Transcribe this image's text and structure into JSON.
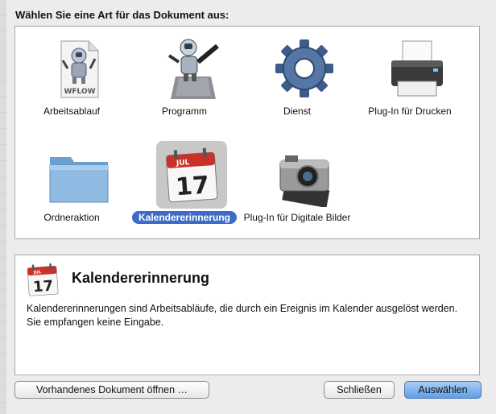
{
  "dialog": {
    "prompt": "Wählen Sie eine Art für das Dokument aus:",
    "selected": "Kalendererinnerung"
  },
  "types": [
    {
      "label": "Arbeitsablauf",
      "icon": "workflow-document-icon",
      "badge": "WFLOW"
    },
    {
      "label": "Programm",
      "icon": "automator-robot-icon"
    },
    {
      "label": "Dienst",
      "icon": "gear-icon"
    },
    {
      "label": "Plug-In für Drucken",
      "icon": "printer-icon"
    },
    {
      "label": "Ordneraktion",
      "icon": "folder-icon"
    },
    {
      "label": "Kalendererinnerung",
      "icon": "calendar-icon",
      "month": "JUL",
      "day": "17"
    },
    {
      "label": "Plug-In für Digitale Bilder",
      "icon": "camera-icon"
    }
  ],
  "description": {
    "icon": "calendar-icon",
    "month": "JUL",
    "day": "17",
    "title": "Kalendererinnerung",
    "text": "Kalendererinnerungen sind Arbeitsabläufe, die durch ein Ereignis im Kalender ausgelöst werden. Sie empfangen keine Eingabe."
  },
  "buttons": {
    "open_existing": "Vorhandenes Dokument öffnen …",
    "close": "Schließen",
    "choose": "Auswählen"
  },
  "colors": {
    "selection": "#3d6cc8",
    "primary_button": "#5f9ee6"
  }
}
